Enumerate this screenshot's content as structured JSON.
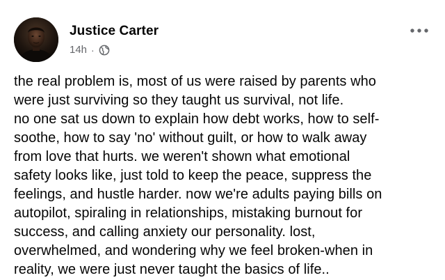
{
  "post": {
    "author": "Justice Carter",
    "timestamp": "14h",
    "separator": "·",
    "privacy_icon": "globe-icon",
    "more_icon": "more-options-icon",
    "body": "the real problem is, most of us were raised by parents who\nwere just surviving so they taught us survival, not life.\nno one sat us down to explain how debt works, how to self-\nsoothe, how to say 'no' without guilt, or how to walk away\nfrom love that hurts. we weren't shown what emotional\nsafety looks like, just told to keep the peace, suppress the\nfeelings, and hustle harder. now we're adults paying bills on\nautopilot, spiraling in relationships, mistaking burnout for\nsuccess, and calling anxiety our personality. lost,\noverwhelmed, and wondering why we feel broken-when in\nreality, we were just never taught the basics of life.."
  },
  "colors": {
    "text_primary": "#050505",
    "text_secondary": "#65676b",
    "background": "#ffffff"
  }
}
